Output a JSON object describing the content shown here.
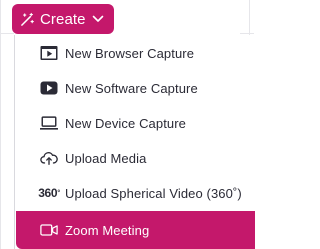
{
  "create_button": {
    "label": "Create",
    "icons": {
      "leading": "magic-wand-icon",
      "trailing": "chevron-down-icon"
    }
  },
  "menu": {
    "items": [
      {
        "label": "New Browser Capture",
        "icon": "browser-play-icon"
      },
      {
        "label": "New Software Capture",
        "icon": "play-button-icon"
      },
      {
        "label": "New Device Capture",
        "icon": "laptop-icon"
      },
      {
        "label": "Upload Media",
        "icon": "cloud-upload-icon"
      },
      {
        "label": "Upload Spherical Video (360˚)",
        "icon": "360-icon",
        "icon_text": "360",
        "icon_sup": "°"
      },
      {
        "label": "Zoom Meeting",
        "icon": "video-camera-icon",
        "active": true
      }
    ]
  },
  "colors": {
    "accent": "#c4186b",
    "text": "#2b2b36"
  }
}
